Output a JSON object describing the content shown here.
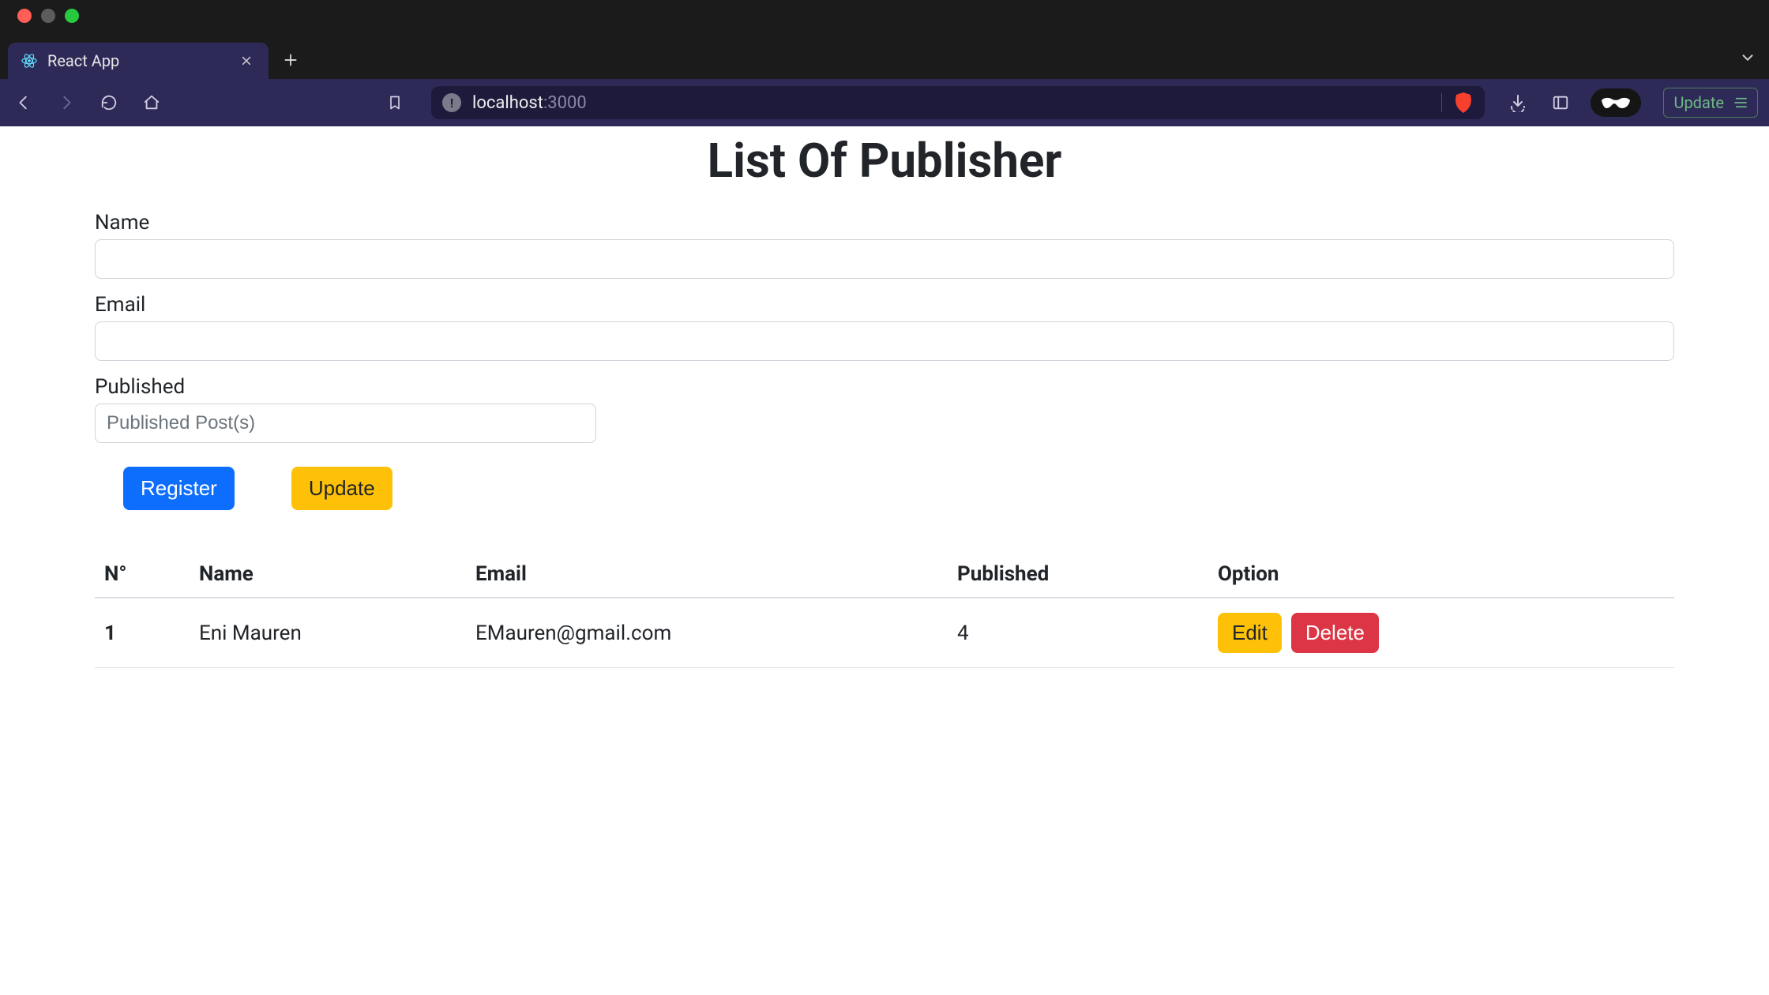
{
  "browser": {
    "tab_title": "React App",
    "url_host": "localhost",
    "url_port": ":3000",
    "update_label": "Update"
  },
  "page": {
    "title": "List Of Publisher",
    "form": {
      "name_label": "Name",
      "name_value": "",
      "email_label": "Email",
      "email_value": "",
      "published_label": "Published",
      "published_placeholder": "Published Post(s)",
      "published_value": ""
    },
    "buttons": {
      "register": "Register",
      "update": "Update"
    },
    "table": {
      "headers": {
        "no": "N°",
        "name": "Name",
        "email": "Email",
        "published": "Published",
        "option": "Option"
      },
      "rows": [
        {
          "no": "1",
          "name": "Eni Mauren",
          "email": "EMauren@gmail.com",
          "published": "4"
        }
      ],
      "row_buttons": {
        "edit": "Edit",
        "delete": "Delete"
      }
    }
  }
}
